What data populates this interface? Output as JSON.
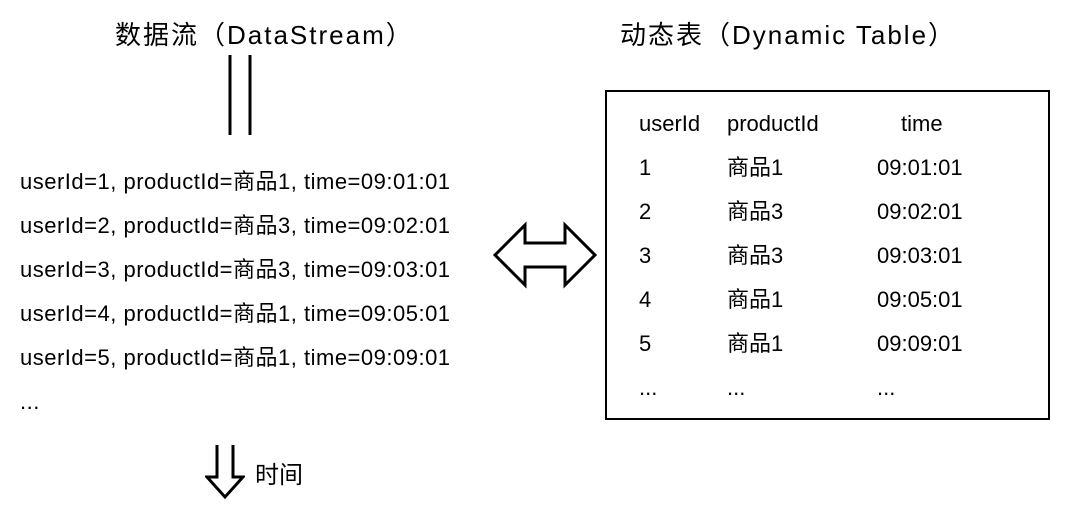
{
  "headings": {
    "left": "数据流（DataStream）",
    "right": "动态表（Dynamic Table）"
  },
  "stream": {
    "rows": [
      "userId=1, productId=商品1, time=09:01:01",
      "userId=2, productId=商品3, time=09:02:01",
      "userId=3, productId=商品3, time=09:03:01",
      "userId=4, productId=商品1, time=09:05:01",
      "userId=5, productId=商品1, time=09:09:01",
      "..."
    ]
  },
  "table": {
    "headers": {
      "userId": "userId",
      "productId": "productId",
      "time": "time"
    },
    "rows": [
      {
        "userId": "1",
        "productId": "商品1",
        "time": "09:01:01"
      },
      {
        "userId": "2",
        "productId": "商品3",
        "time": "09:02:01"
      },
      {
        "userId": "3",
        "productId": "商品3",
        "time": "09:03:01"
      },
      {
        "userId": "4",
        "productId": "商品1",
        "time": "09:05:01"
      },
      {
        "userId": "5",
        "productId": "商品1",
        "time": "09:09:01"
      },
      {
        "userId": "...",
        "productId": "...",
        "time": "..."
      }
    ]
  },
  "labels": {
    "time": "时间"
  }
}
